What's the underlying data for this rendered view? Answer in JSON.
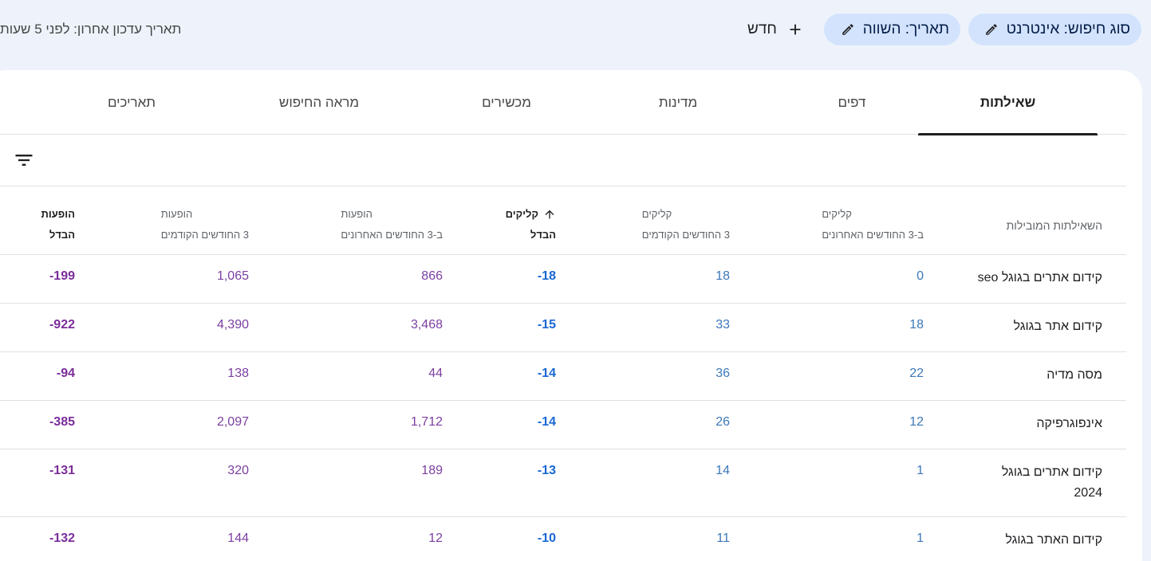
{
  "toolbar": {
    "search_type_chip": "סוג חיפוש: אינטרנט",
    "date_chip": "תאריך: השווה",
    "new_label": "חדש",
    "last_updated": "תאריך עדכון אחרון: לפני 5 שעות"
  },
  "tabs": [
    {
      "label": "שאילתות",
      "active": true
    },
    {
      "label": "דפים",
      "active": false
    },
    {
      "label": "מדינות",
      "active": false
    },
    {
      "label": "מכשירים",
      "active": false
    },
    {
      "label": "מראה החיפוש",
      "active": false
    },
    {
      "label": "תאריכים",
      "active": false
    }
  ],
  "table": {
    "headers": {
      "query": "השאילתות המובילות",
      "clicks_last_1": "קליקים",
      "clicks_last_2": "ב-3 החודשים האחרונים",
      "clicks_prev_1": "קליקים",
      "clicks_prev_2": "3 החודשים הקודמים",
      "clicks_diff_1": "קליקים",
      "clicks_diff_2": "הבדל",
      "impr_last_1": "הופעות",
      "impr_last_2": "ב-3 החודשים האחרונים",
      "impr_prev_1": "הופעות",
      "impr_prev_2": "3 החודשים הקודמים",
      "impr_diff_1": "הופעות",
      "impr_diff_2": "הבדל"
    },
    "rows": [
      {
        "query": "קידום אתרים בגוגל seo",
        "clicks_last": "0",
        "clicks_prev": "18",
        "clicks_diff": "-18",
        "impr_last": "866",
        "impr_prev": "1,065",
        "impr_diff": "-199"
      },
      {
        "query": "קידום אתר בגוגל",
        "clicks_last": "18",
        "clicks_prev": "33",
        "clicks_diff": "-15",
        "impr_last": "3,468",
        "impr_prev": "4,390",
        "impr_diff": "-922"
      },
      {
        "query": "מסה מדיה",
        "clicks_last": "22",
        "clicks_prev": "36",
        "clicks_diff": "-14",
        "impr_last": "44",
        "impr_prev": "138",
        "impr_diff": "-94"
      },
      {
        "query": "אינפוגרפיקה",
        "clicks_last": "12",
        "clicks_prev": "26",
        "clicks_diff": "-14",
        "impr_last": "1,712",
        "impr_prev": "2,097",
        "impr_diff": "-385"
      },
      {
        "query": "קידום אתרים בגוגל 2024",
        "clicks_last": "1",
        "clicks_prev": "14",
        "clicks_diff": "-13",
        "impr_last": "189",
        "impr_prev": "320",
        "impr_diff": "-131"
      },
      {
        "query": "קידום האתר בגוגל",
        "clicks_last": "1",
        "clicks_prev": "11",
        "clicks_diff": "-10",
        "impr_last": "12",
        "impr_prev": "144",
        "impr_diff": "-132"
      }
    ]
  },
  "colors": {
    "chip_bg": "#d3e3fd",
    "clicks": "#3c78b8",
    "impressions": "#7b3fa0",
    "page_bg": "#eef3fb"
  },
  "icons": [
    "pencil-icon",
    "plus-icon",
    "filter-icon",
    "arrow-up-icon"
  ]
}
